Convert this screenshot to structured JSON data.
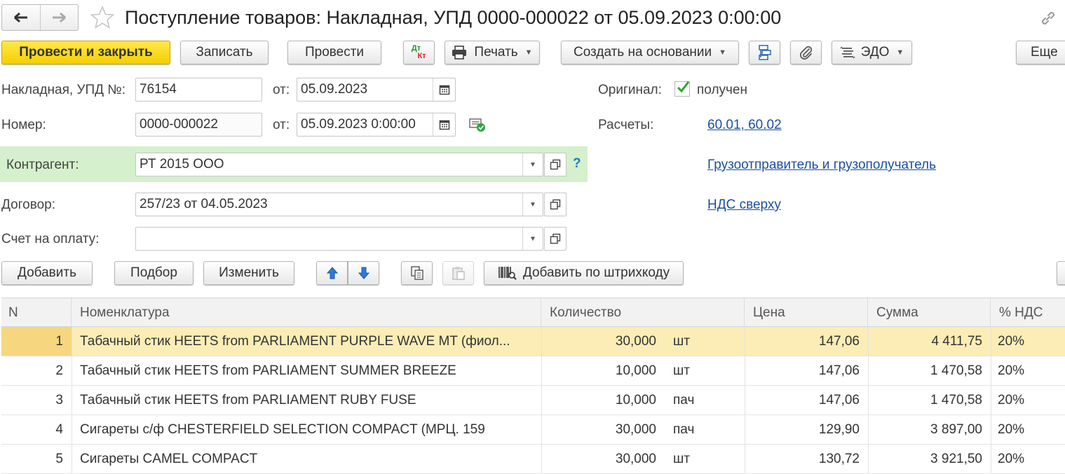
{
  "window": {
    "title": "Поступление товаров: Накладная, УПД 0000-000022 от 05.09.2023 0:00:00"
  },
  "toolbar": {
    "post_close": "Провести и закрыть",
    "save": "Записать",
    "post": "Провести",
    "dt": "Дт",
    "kt": "Кт",
    "print": "Печать",
    "create_based": "Создать на основании",
    "edo": "ЭДО",
    "more": "Еще"
  },
  "form": {
    "invoice_label": "Накладная, УПД №:",
    "invoice_number": "76154",
    "from_label": "от:",
    "invoice_date": "05.09.2023",
    "number_label": "Номер:",
    "number": "0000-000022",
    "number_date": "05.09.2023  0:00:00",
    "original_label": "Оригинал:",
    "original_value": "получен",
    "settlements_label": "Расчеты:",
    "settlements_link": "60.01, 60.02",
    "counterparty_label": "Контрагент:",
    "counterparty": "РТ 2015 ООО",
    "help": "?",
    "consignor_link": "Грузоотправитель и грузополучатель",
    "contract_label": "Договор:",
    "contract": "257/23 от 04.05.2023",
    "vat_link": "НДС сверху",
    "payment_label": "Счет на оплату:",
    "payment": ""
  },
  "table_toolbar": {
    "add": "Добавить",
    "pick": "Подбор",
    "change": "Изменить",
    "barcode": "Добавить по штрихкоду"
  },
  "table": {
    "headers": {
      "n": "N",
      "item": "Номенклатура",
      "qty": "Количество",
      "price": "Цена",
      "sum": "Сумма",
      "vat": "% НДС"
    },
    "rows": [
      {
        "n": "1",
        "item": "Табачный стик HEETS from PARLIAMENT PURPLE WAVE MT (фиол...",
        "qty": "30,000",
        "unit": "шт",
        "price": "147,06",
        "sum": "4 411,75",
        "vat": "20%"
      },
      {
        "n": "2",
        "item": "Табачный стик HEETS from PARLIAMENT SUMMER BREEZE",
        "qty": "10,000",
        "unit": "шт",
        "price": "147,06",
        "sum": "1 470,58",
        "vat": "20%"
      },
      {
        "n": "3",
        "item": "Табачный стик HEETS from PARLIAMENT RUBY FUSE",
        "qty": "10,000",
        "unit": "пач",
        "price": "147,06",
        "sum": "1 470,58",
        "vat": "20%"
      },
      {
        "n": "4",
        "item": "Сигареты с/ф CHESTERFIELD SELECTION COMPACT (МРЦ. 159",
        "qty": "30,000",
        "unit": "пач",
        "price": "129,90",
        "sum": "3 897,00",
        "vat": "20%"
      },
      {
        "n": "5",
        "item": "Сигареты CAMEL COMPACT",
        "qty": "30,000",
        "unit": "шт",
        "price": "130,72",
        "sum": "3 921,50",
        "vat": "20%"
      }
    ]
  },
  "colors": {
    "primary_button": "#f5cf00",
    "counterparty_bg": "#d5f0cc",
    "link": "#1a4f9f",
    "selected_row": "#fbedb5",
    "check": "#2aa63a"
  },
  "icons": [
    "arrow-left-icon",
    "arrow-right-icon",
    "star-icon",
    "link-icon",
    "printer-icon",
    "structure-icon",
    "paperclip-icon",
    "edo-icon",
    "calendar-icon",
    "doc-check-icon",
    "checkbox-icon",
    "dropdown-icon",
    "open-icon",
    "arrow-up-icon",
    "arrow-down-icon",
    "copy-icon",
    "paste-icon",
    "barcode-icon"
  ]
}
